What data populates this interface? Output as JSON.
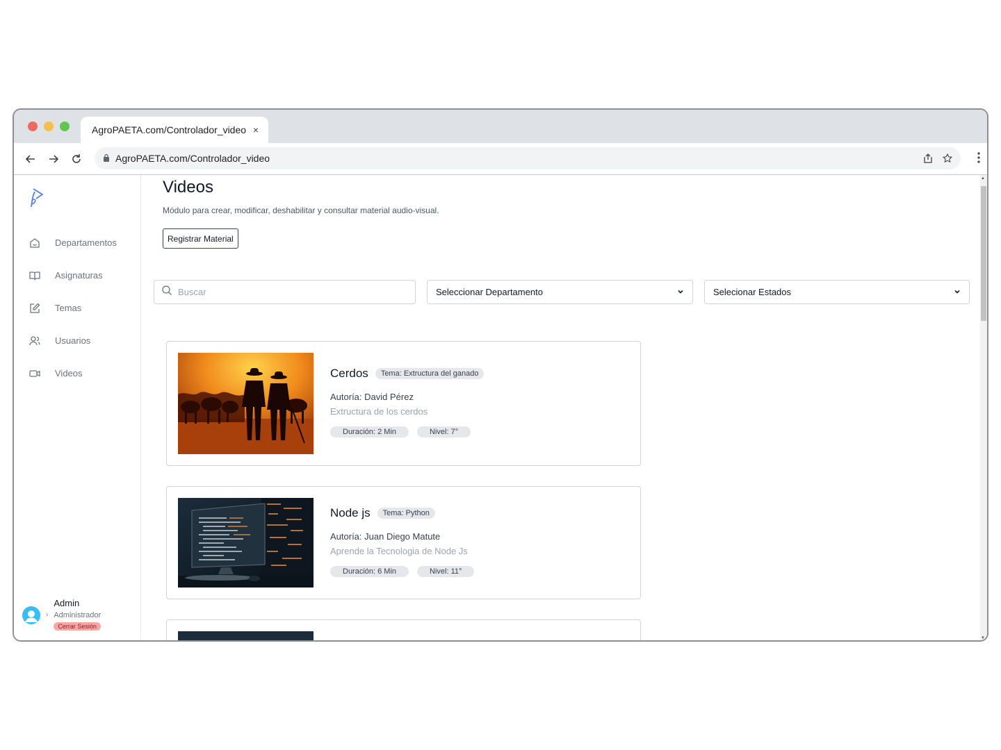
{
  "browser": {
    "tab_title": "AgroPAETA.com/Controlador_video",
    "tab_close": "×",
    "url": "AgroPAETA.com/Controlador_video"
  },
  "sidebar": {
    "items": [
      {
        "label": "Departamentos",
        "icon": "home-icon"
      },
      {
        "label": "Asignaturas",
        "icon": "book-icon"
      },
      {
        "label": "Temas",
        "icon": "edit-icon"
      },
      {
        "label": "Usuarios",
        "icon": "users-icon"
      },
      {
        "label": "Videos",
        "icon": "video-icon"
      }
    ],
    "user": {
      "name": "Admin",
      "role": "Administrador",
      "logout": "Cerrar Sesión",
      "chevron": "›"
    }
  },
  "main": {
    "title": "Videos",
    "subtitle": "Módulo para crear, modificar, deshabilitar y consultar material audio-visual.",
    "register_button": "Registrar Material",
    "search_placeholder": "Buscar",
    "department_select": "Seleccionar Departamento",
    "status_select": "Selecionar Estados",
    "cards": [
      {
        "title": "Cerdos",
        "topic": "Tema: Extructura del ganado",
        "author": "Autoría: David Pérez",
        "description": "Extructura de los cerdos",
        "duration": "Duración: 2 Min",
        "level": "Nivel: 7°"
      },
      {
        "title": "Node js",
        "topic": "Tema: Python",
        "author": "Autoría: Juan Diego Matute",
        "description": "Aprende la Tecnologia de Node Js",
        "duration": "Duración: 6 Min",
        "level": "Nivel: 11°"
      }
    ]
  },
  "colors": {
    "logout_bg": "#fca5a5",
    "accent_logo": "#4f7fe8",
    "avatar": "#38bdf8"
  }
}
